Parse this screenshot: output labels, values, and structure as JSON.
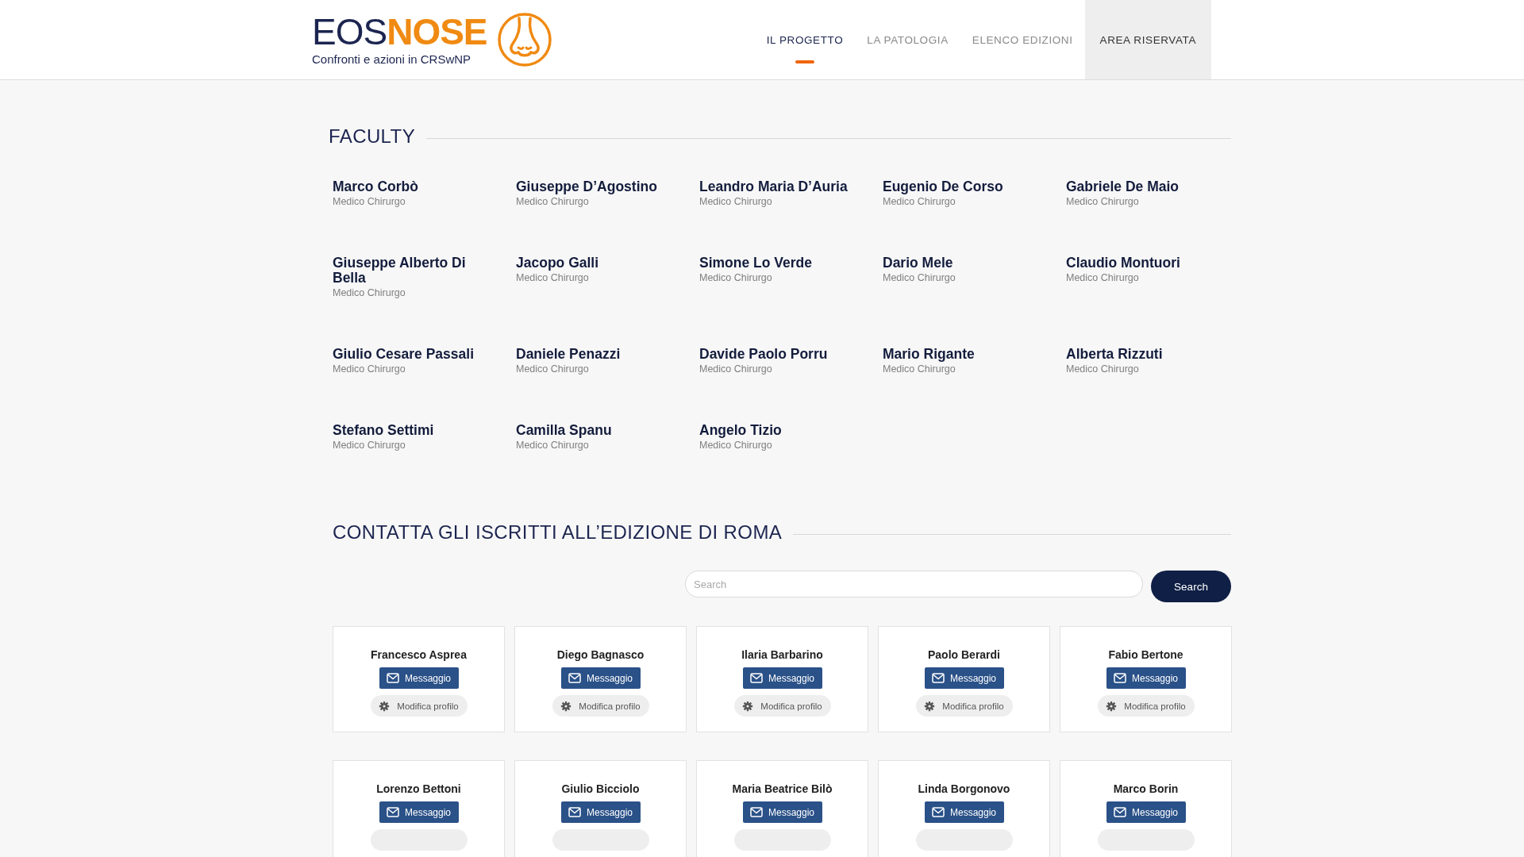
{
  "header": {
    "logo": {
      "part_1": "EOS",
      "part_2": "NOSE",
      "tagline": "Confronti e azioni in CRSwNP"
    },
    "nav": [
      {
        "label": "IL PROGETTO",
        "selected": true,
        "kind": "link"
      },
      {
        "label": "LA PATOLOGIA",
        "selected": false,
        "kind": "link"
      },
      {
        "label": "ELENCO EDIZIONI",
        "selected": false,
        "kind": "link"
      },
      {
        "label": "AREA RISERVATA",
        "selected": false,
        "kind": "highlight"
      }
    ]
  },
  "faculty": {
    "title": "FACULTY",
    "members": [
      {
        "name": "Marco Corbò",
        "role": "Medico Chirurgo"
      },
      {
        "name": "Giuseppe D’Agostino",
        "role": "Medico Chirurgo"
      },
      {
        "name": "Leandro Maria D’Auria",
        "role": "Medico Chirurgo"
      },
      {
        "name": "Eugenio De Corso",
        "role": "Medico Chirurgo"
      },
      {
        "name": "Gabriele De Maio",
        "role": "Medico Chirurgo"
      },
      {
        "name": "Giuseppe Alberto Di Bella",
        "role": "Medico Chirurgo"
      },
      {
        "name": "Jacopo Galli",
        "role": "Medico Chirurgo"
      },
      {
        "name": "Simone Lo Verde",
        "role": "Medico Chirurgo"
      },
      {
        "name": "Dario Mele",
        "role": "Medico Chirurgo"
      },
      {
        "name": "Claudio Montuori",
        "role": "Medico Chirurgo"
      },
      {
        "name": "Giulio Cesare Passali",
        "role": "Medico Chirurgo"
      },
      {
        "name": "Daniele Penazzi",
        "role": "Medico Chirurgo"
      },
      {
        "name": "Davide Paolo Porru",
        "role": "Medico Chirurgo"
      },
      {
        "name": "Mario Rigante",
        "role": "Medico Chirurgo"
      },
      {
        "name": "Alberta Rizzuti",
        "role": "Medico Chirurgo"
      },
      {
        "name": "Stefano Settimi",
        "role": "Medico Chirurgo"
      },
      {
        "name": "Camilla Spanu",
        "role": "Medico Chirurgo"
      },
      {
        "name": "Angelo Tizio",
        "role": "Medico Chirurgo"
      }
    ]
  },
  "contacts": {
    "title": "CONTATTA GLI ISCRITTI ALL’EDIZIONE DI ROMA",
    "search": {
      "placeholder": "Search",
      "button": "Search"
    },
    "people": [
      {
        "name": "Francesco Asprea",
        "message": "Messaggio",
        "edit": "Modifica profilo"
      },
      {
        "name": "Diego Bagnasco",
        "message": "Messaggio",
        "edit": "Modifica profilo"
      },
      {
        "name": "Ilaria Barbarino",
        "message": "Messaggio",
        "edit": "Modifica profilo"
      },
      {
        "name": "Paolo Berardi",
        "message": "Messaggio",
        "edit": "Modifica profilo"
      },
      {
        "name": "Fabio Bertone",
        "message": "Messaggio",
        "edit": "Modifica profilo"
      },
      {
        "name": "Lorenzo Bettoni",
        "message": "Messaggio"
      },
      {
        "name": "Giulio Bicciolo",
        "message": "Messaggio"
      },
      {
        "name": "Maria Beatrice Bilò",
        "message": "Messaggio"
      },
      {
        "name": "Linda Borgonovo",
        "message": "Messaggio"
      },
      {
        "name": "Marco Borin",
        "message": "Messaggio"
      }
    ]
  }
}
